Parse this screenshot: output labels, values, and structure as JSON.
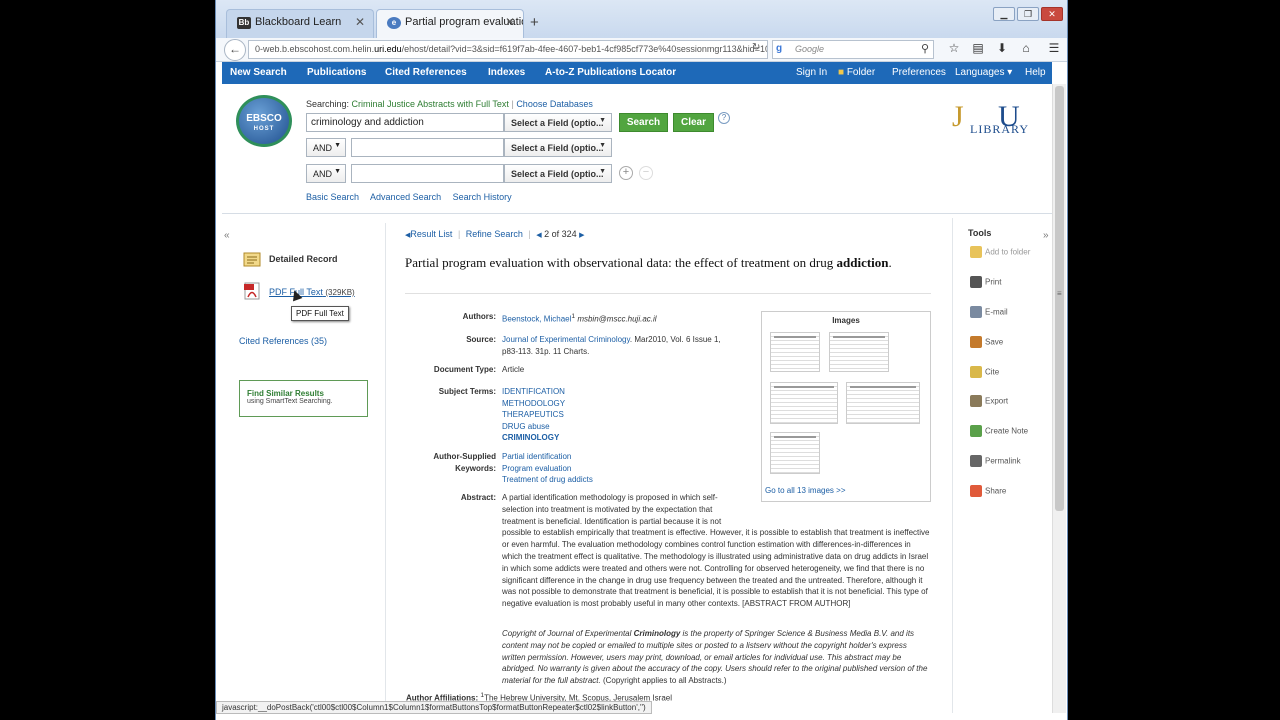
{
  "browser": {
    "tabs": [
      {
        "favicon": "Bb",
        "label": "Blackboard Learn"
      },
      {
        "favicon": "e",
        "label": "Partial program evaluation ..."
      }
    ],
    "new_tab": "+",
    "window_controls": [
      "minimize-icon",
      "maximize-icon",
      "close-icon"
    ],
    "url_pre": "0-web.b.ebscohost.com.helin.",
    "url_host": "uri.edu",
    "url_post": "/ehost/detail?vid=3&sid=f619f7ab-4fee-4607-beb1-4cf985cf773e%40sessionmgr113&hid=108",
    "search_placeholder": "Google",
    "status_text": "javascript:__doPostBack('ctl00$ctl00$Column1$Column1$formatButtonsTop$formatButtonRepeater$ctl02$linkButton','')"
  },
  "topmenu": {
    "left": [
      "New Search",
      "Publications",
      "Cited References",
      "Indexes",
      "A-to-Z Publications Locator"
    ],
    "right": [
      "Sign In",
      "Folder",
      "Preferences",
      "Languages ▾",
      "Help"
    ]
  },
  "search": {
    "logo_text": "EBSCO",
    "logo_sub": "HOST",
    "searching_label": "Searching:",
    "database": "Criminal Justice Abstracts with Full Text",
    "choose_db": "Choose Databases",
    "query1": "criminology and addiction",
    "query2": "",
    "query3": "",
    "field_label": "Select a Field (optio...",
    "bool1": "AND",
    "bool2": "AND",
    "search_btn": "Search",
    "clear_btn": "Clear",
    "help": "?",
    "add": "+",
    "remove": "−",
    "links": [
      "Basic Search",
      "Advanced Search",
      "Search History"
    ]
  },
  "library_logo": {
    "j": "J",
    "u": "U",
    "library": "LIBRARY"
  },
  "left": {
    "collapse": "«",
    "detailed_record": "Detailed Record",
    "pdf_label": "PDF Full Text",
    "pdf_size": "(329KB)",
    "tooltip": "PDF Full Text",
    "cited_refs": "Cited References (35)",
    "similar_title": "Find Similar Results",
    "similar_sub": "using SmartText Searching."
  },
  "record": {
    "result_list": "Result List",
    "refine_search": "Refine Search",
    "position": "2 of 324",
    "title_plain": "Partial program evaluation with observational data: the effect of treatment on drug ",
    "title_bold": "addiction",
    "title_end": ".",
    "authors_label": "Authors:",
    "author_name": "Beenstock, Michael",
    "author_sup": "1",
    "author_email": "msbin@mscc.huji.ac.il",
    "source_label": "Source:",
    "source_journal": "Journal of Experimental Criminology",
    "source_rest": ". Mar2010, Vol. 6 Issue 1,",
    "source_line2": "p83-113. 31p. 11 Charts.",
    "doctype_label": "Document Type:",
    "doctype": "Article",
    "subject_label": "Subject Terms:",
    "subjects": [
      "IDENTIFICATION",
      "METHODOLOGY",
      "THERAPEUTICS",
      "DRUG abuse",
      "CRIMINOLOGY"
    ],
    "keywords_label1": "Author-Supplied",
    "keywords_label2": "Keywords:",
    "keywords": [
      "Partial identification",
      "Program evaluation",
      "Treatment of drug addicts"
    ],
    "abstract_label": "Abstract:",
    "abstract": "A partial identification methodology is proposed in which self-selection into treatment is motivated by the expectation that treatment is beneficial. Identification is partial because it is not possible to establish empirically that treatment is effective. However, it is possible to establish that treatment is ineffective or even harmful. The evaluation methodology combines control function estimation with differences-in-differences in which the treatment effect is qualitative. The methodology is illustrated using administrative data on drug addicts in Israel in which some addicts were treated and others were not. Controlling for observed heterogeneity, we find that there is no significant difference in the change in drug use frequency between the treated and the untreated. Therefore, although it was not possible to demonstrate that treatment is beneficial, it is possible to establish that it is not beneficial. This type of negative evaluation is most probably useful in many other contexts. [ABSTRACT FROM AUTHOR]",
    "copyright_pre": "Copyright of Journal of Experimental ",
    "copyright_bold": "Criminology",
    "copyright_post": " is the property of Springer Science & Business Media B.V. and its content may not be copied or emailed to multiple sites or posted to a listserv without the copyright holder's express written permission. However, users may print, download, or email articles for individual use. This abstract may be abridged. No warranty is given about the accuracy of the copy. Users should refer to the original published version of the material for the full abstract.",
    "copyright_end": " (Copyright applies to all Abstracts.)",
    "affil_label": "Author Affiliations:",
    "affil_sup": "1",
    "affil": "The Hebrew University, Mt. Scopus, Jerusalem Israel"
  },
  "images": {
    "heading": "Images",
    "goto": "Go to all 13 images >>"
  },
  "tools": {
    "heading": "Tools",
    "expand": "»",
    "items": [
      {
        "label": "Add to folder",
        "icon": "folder-add-icon",
        "color": "#e8c35a"
      },
      {
        "label": "Print",
        "icon": "printer-icon",
        "color": "#555555"
      },
      {
        "label": "E-mail",
        "icon": "email-icon",
        "color": "#7a8aa0"
      },
      {
        "label": "Save",
        "icon": "save-icon",
        "color": "#c47a2c"
      },
      {
        "label": "Cite",
        "icon": "cite-icon",
        "color": "#d9b84a"
      },
      {
        "label": "Export",
        "icon": "export-icon",
        "color": "#8a7a5a"
      },
      {
        "label": "Create Note",
        "icon": "note-icon",
        "color": "#5aa04a"
      },
      {
        "label": "Permalink",
        "icon": "link-icon",
        "color": "#666666"
      },
      {
        "label": "Share",
        "icon": "share-icon",
        "color": "#e05a3a"
      }
    ]
  }
}
